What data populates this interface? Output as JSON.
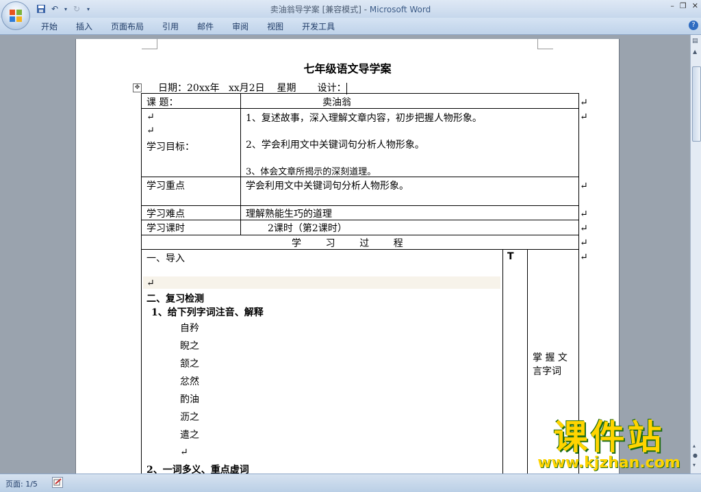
{
  "window": {
    "doc_name": "卖油翁导学案 [兼容模式] - ",
    "app_name": "Microsoft Word"
  },
  "ribbon": {
    "tabs": [
      "开始",
      "插入",
      "页面布局",
      "引用",
      "邮件",
      "审阅",
      "视图",
      "开发工具"
    ],
    "help": "?"
  },
  "doc": {
    "title": "七年级语文导学案",
    "dateline": "日期：20xx年   xx月2日    星期       设计：",
    "r1_label": "课    题：",
    "r1_value": "卖油翁",
    "goal_label": "学习目标：",
    "goals": [
      "1、复述故事，深入理解文章内容，初步把握人物形象。",
      "2、学会利用文中关键词句分析人物形象。",
      "3、体会文章所揭示的深刻道理。"
    ],
    "key_label": "学习重点",
    "key_value": "学会利用文中关键词句分析人物形象。",
    "diff_label": "学习难点",
    "diff_value": "理解熟能生巧的道理",
    "hours_label": "学习课时",
    "hours_value": "2课时（第2课时）",
    "process_header": "学        习        过        程",
    "sec1": "一、导入",
    "sec2": "二、复习检测",
    "sub1": "1、给下列字词注音、解释",
    "words": [
      "自矜",
      "睨之",
      "颔之",
      "忿然",
      "酌油",
      "沥之",
      "遣之"
    ],
    "sub2": "2、一词多义、重点虚词",
    "t_mark": "T",
    "side_note_1": "掌 握 文",
    "side_note_2": "言字词"
  },
  "status": {
    "page": "页面: 1/5"
  },
  "watermark": {
    "big": "课件站",
    "url": "www.kjzhan.com"
  }
}
